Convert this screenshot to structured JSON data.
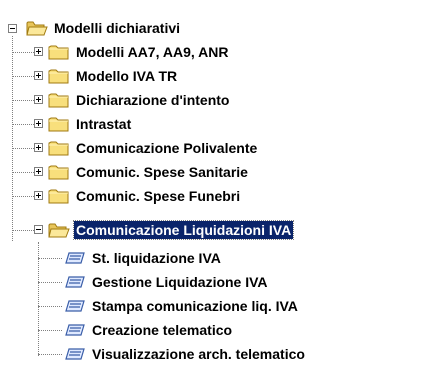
{
  "tree": {
    "root": {
      "label": "Modelli dichiarativi",
      "expanded": true,
      "icon": "folder-open-icon"
    },
    "children": [
      {
        "label": "Modelli AA7, AA9, ANR",
        "expanded": false,
        "icon": "folder-icon"
      },
      {
        "label": "Modello IVA TR",
        "expanded": false,
        "icon": "folder-icon"
      },
      {
        "label": "Dichiarazione d'intento",
        "expanded": false,
        "icon": "folder-icon"
      },
      {
        "label": "Intrastat",
        "expanded": false,
        "icon": "folder-icon"
      },
      {
        "label": "Comunicazione Polivalente",
        "expanded": false,
        "icon": "folder-icon"
      },
      {
        "label": "Comunic. Spese Sanitarie",
        "expanded": false,
        "icon": "folder-icon"
      },
      {
        "label": "Comunic. Spese Funebri",
        "expanded": false,
        "icon": "folder-icon"
      },
      {
        "label": "Comunicazione Liquidazioni IVA",
        "expanded": true,
        "selected": true,
        "icon": "folder-open-icon",
        "children": [
          {
            "label": "St. liquidazione IVA",
            "icon": "program-icon"
          },
          {
            "label": "Gestione Liquidazione IVA",
            "icon": "program-icon"
          },
          {
            "label": "Stampa comunicazione liq. IVA",
            "icon": "program-icon"
          },
          {
            "label": "Creazione telematico",
            "icon": "program-icon"
          },
          {
            "label": "Visualizzazione arch. telematico",
            "icon": "program-icon"
          }
        ]
      }
    ],
    "colors": {
      "selection_background": "#0a246a",
      "selection_text": "#ffffff",
      "folder_fill": "#f8df7c",
      "folder_stroke": "#a07a10",
      "program_icon": "#3a5ea8"
    }
  }
}
